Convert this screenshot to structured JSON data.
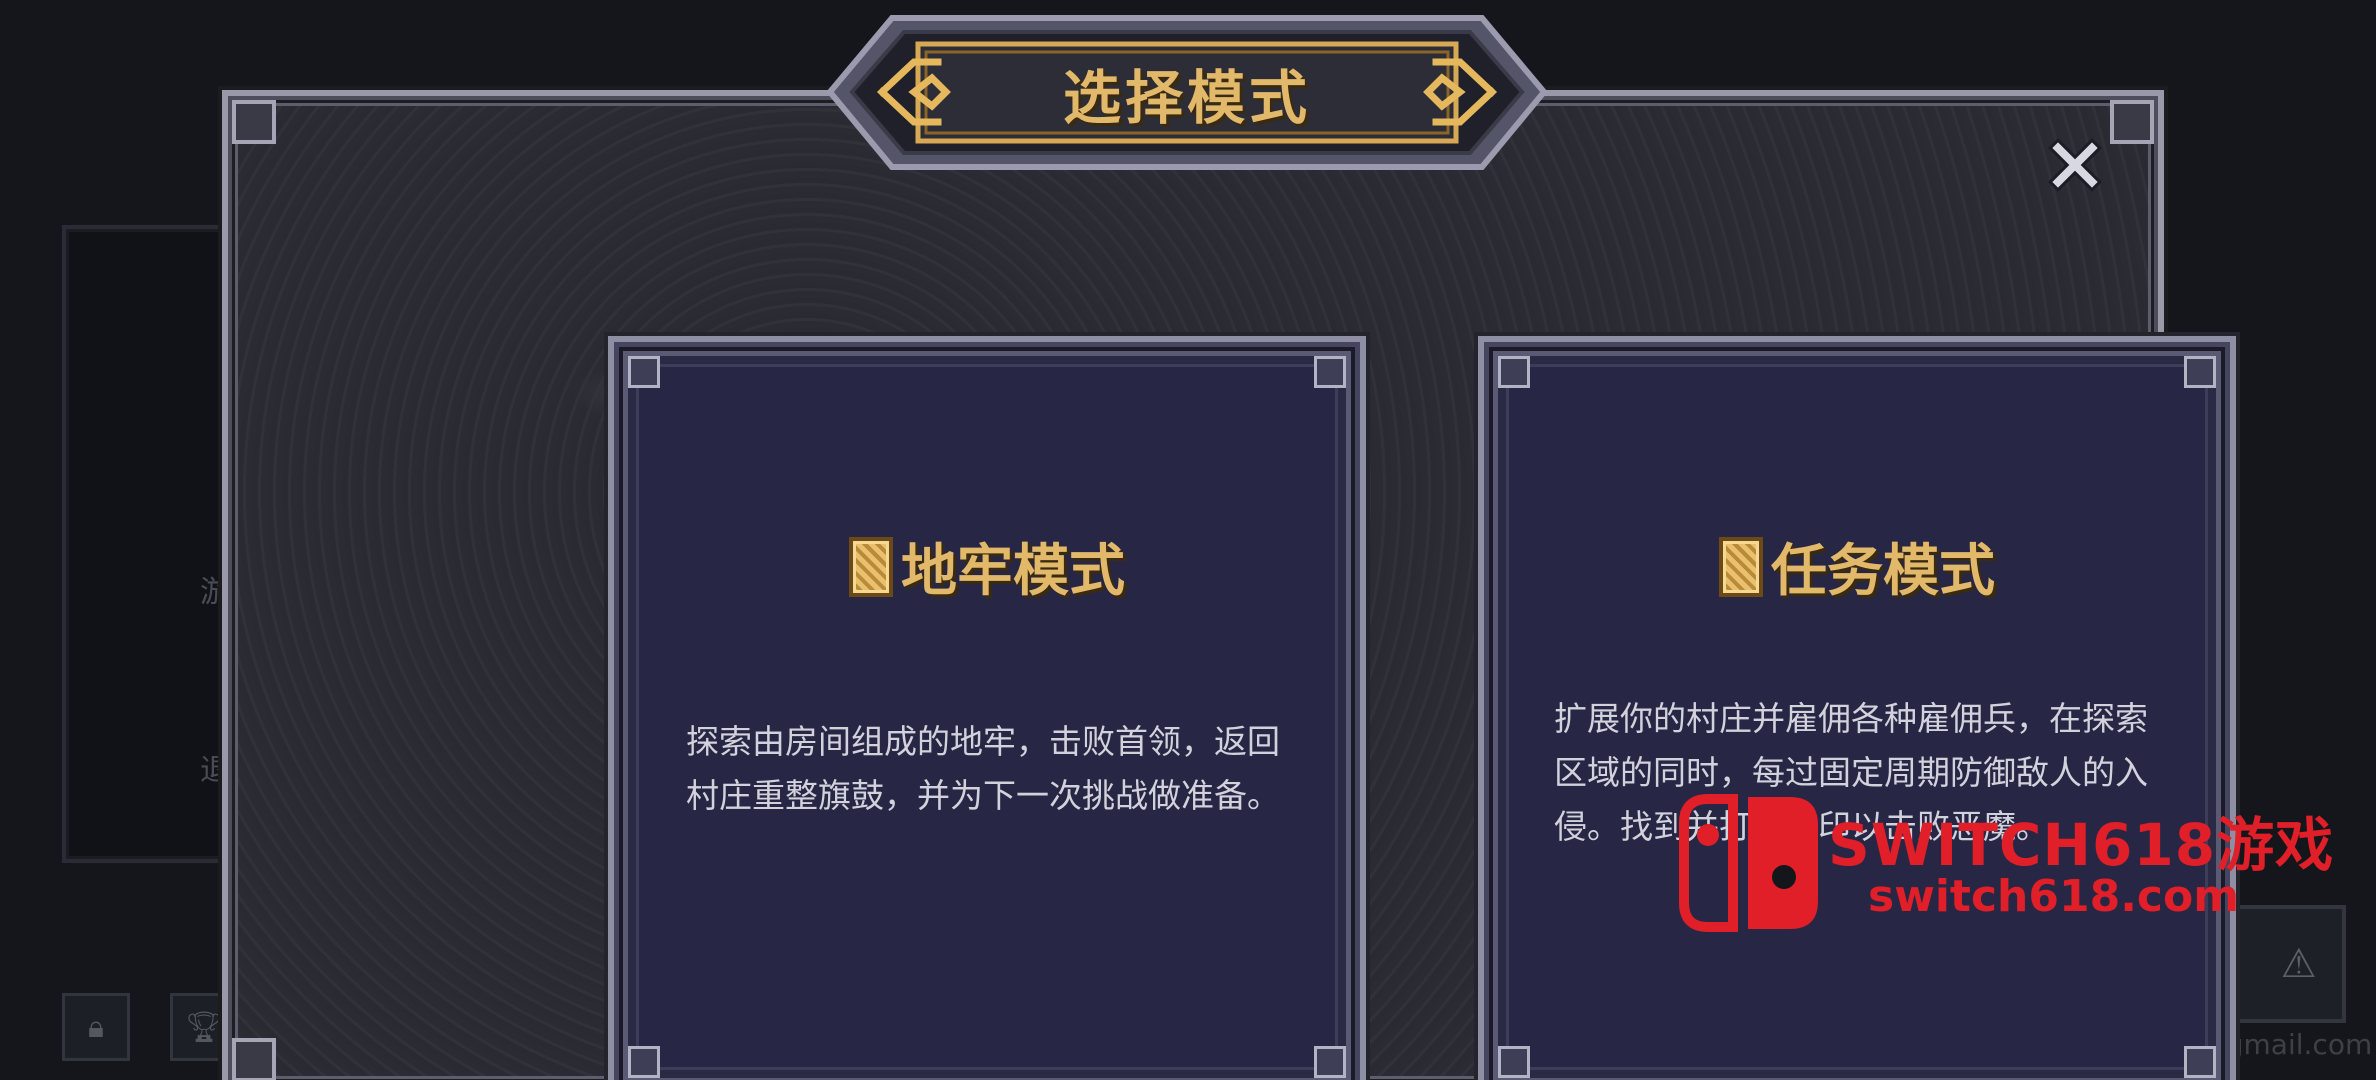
{
  "modal": {
    "title": "选择模式",
    "close_icon": "close-x-icon"
  },
  "modes": [
    {
      "title": "地牢模式",
      "description": "探索由房间组成的地牢，击败首领，返回村庄重整旗鼓，并为下一次挑战做准备。",
      "emblem_icon": "rune-emblem-icon"
    },
    {
      "title": "任务模式",
      "description": "扩展你的村庄并雇佣各种雇佣兵，在探索区域的同时，每过固定周期防御敌人的入侵。找到并打破封印以击败恶魔。",
      "emblem_icon": "rune-emblem-icon"
    }
  ],
  "background": {
    "left_label_a": "游",
    "left_label_b": "退",
    "email_fragment": "ics@gmail.com",
    "icons": [
      "lock-icon",
      "trophy-icon",
      "scroll-icon",
      "warning-icon"
    ]
  },
  "watermark": {
    "line1": "SWITCH618游戏",
    "line2": "switch618.com"
  },
  "colors": {
    "accent_gold": "#e2b86a",
    "card_bg": "#272745",
    "watermark_red": "#e01f28"
  }
}
